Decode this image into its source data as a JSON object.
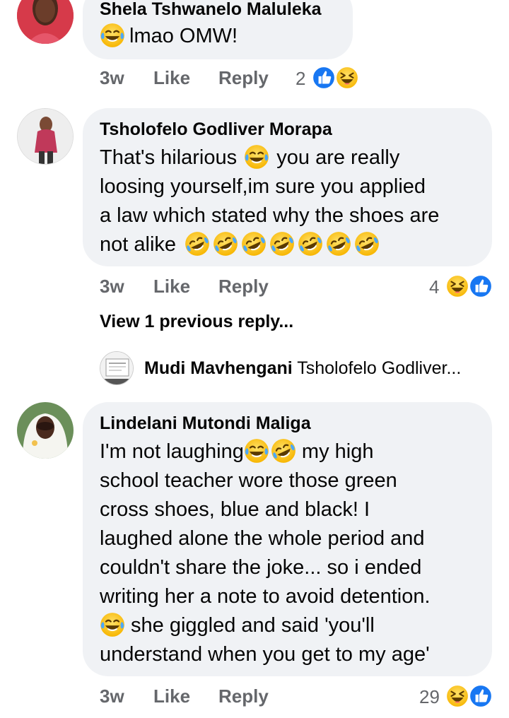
{
  "comments": [
    {
      "author": "Shela Tshwanelo Maluleka",
      "lines": [
        "lmao OMW!"
      ],
      "time": "3w",
      "like_label": "Like",
      "reply_label": "Reply",
      "reaction_count": "2",
      "reactions": [
        "like-reaction",
        "haha-reaction"
      ]
    },
    {
      "author": "Tsholofelo Godliver Morapa",
      "lines": [
        "That's hilarious",
        "you are really",
        "loosing yourself,im sure you applied",
        "a law which stated why the shoes are",
        "not alike"
      ],
      "time": "3w",
      "like_label": "Like",
      "reply_label": "Reply",
      "reaction_count": "4",
      "reactions": [
        "haha-reaction",
        "like-reaction"
      ]
    },
    {
      "author": "Lindelani Mutondi Maliga",
      "lines": [
        "I'm not laughing",
        "my high",
        "school teacher wore those green",
        "cross shoes, blue and black! I",
        "laughed alone the whole period and",
        "couldn't share the joke... so i ended",
        "writing her a note to avoid detention.",
        "she giggled and said 'you'll",
        "understand when you get to my age'"
      ],
      "time": "3w",
      "like_label": "Like",
      "reply_label": "Reply",
      "reaction_count": "29",
      "reactions": [
        "haha-reaction",
        "like-reaction"
      ]
    }
  ],
  "view_previous": "View 1 previous reply...",
  "reply_preview": {
    "author": "Mudi Mavhengani",
    "text": "Tsholofelo Godliver..."
  },
  "colors": {
    "bubble": "#f0f2f5",
    "meta_text": "#65676b",
    "like_blue": "#1877f2",
    "emoji_yellow": "#ffcc33"
  }
}
